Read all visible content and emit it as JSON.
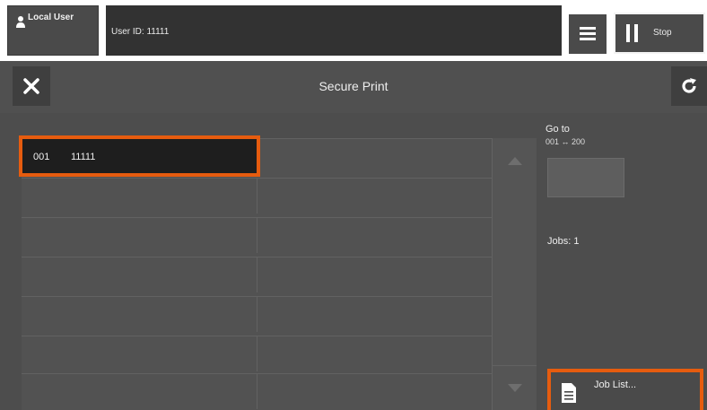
{
  "header": {
    "user_label": "Local User",
    "user_id": "User ID: 11111",
    "stop_label": "Stop"
  },
  "screen": {
    "title": "Secure Print"
  },
  "job_list": {
    "rows": [
      {
        "number": "001",
        "user_id": "11111"
      }
    ]
  },
  "side_panel": {
    "goto_label": "Go to",
    "goto_range": "001 ↔ 200",
    "jobs_count": "Jobs: 1",
    "job_list_button": "Job List..."
  },
  "colors": {
    "highlight": "#e65c0f",
    "background": "#4d4d4d"
  },
  "icons": [
    "person-icon",
    "menu-icon",
    "pause-icon",
    "close-icon",
    "refresh-icon",
    "scroll-up-icon",
    "scroll-down-icon",
    "document-icon"
  ]
}
